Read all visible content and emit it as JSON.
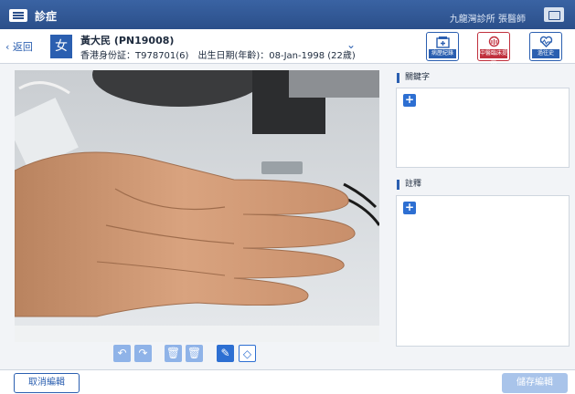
{
  "topbar": {
    "title": "診症",
    "clinic_user": "九龍灣診所 張醫師"
  },
  "patient": {
    "back_label": "返回",
    "gender": "女",
    "name": "黃大民 (PN19008)",
    "info": "香港身份証：T978701(6)　出生日期(年齡)：08-Jan-1998 (22歲)"
  },
  "header_buttons": [
    {
      "label": "病歷紀錄",
      "icon": "medical-record-icon"
    },
    {
      "label": "中醫臨床提示",
      "icon": "clinical-alert-icon",
      "color": "#c0303d"
    },
    {
      "label": "過往史",
      "icon": "heart-history-icon"
    }
  ],
  "panels": {
    "keywords_title": "關鍵字",
    "notes_title": "註釋"
  },
  "toolbar_icons": [
    "undo-icon",
    "redo-icon",
    "delete-icon",
    "delete-all-icon",
    "pen-icon",
    "eraser-icon"
  ],
  "bottom": {
    "cancel_label": "取消編輯",
    "save_label": "儲存編輯"
  },
  "colors": {
    "primary": "#2b5fb0",
    "alert": "#c0303d",
    "disabled": "#a9c4ea"
  }
}
